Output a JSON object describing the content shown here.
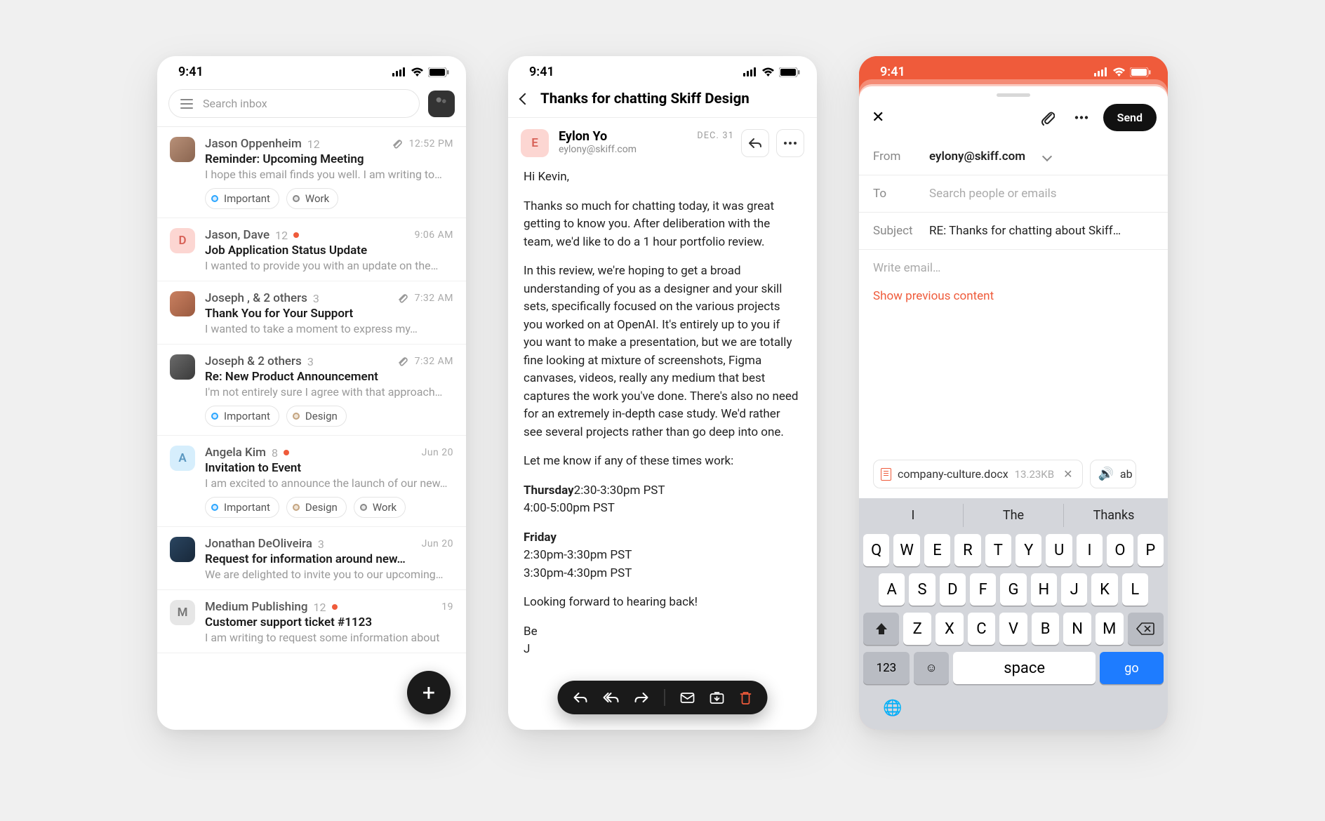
{
  "status": {
    "time": "9:41"
  },
  "inbox": {
    "searchPlaceholder": "Search inbox",
    "items": [
      {
        "sender": "Jason Oppenheim",
        "count": "12",
        "dot": false,
        "clip": true,
        "time": "12:52 PM",
        "subject": "Reminder: Upcoming Meeting",
        "preview": "I hope this email finds you well. I am writing to…",
        "avatar": "photo1",
        "tags": [
          {
            "c": "blue",
            "t": "Important"
          },
          {
            "c": "gray",
            "t": "Work"
          }
        ]
      },
      {
        "sender": "Jason, Dave",
        "count": "12",
        "dot": true,
        "clip": false,
        "time": "9:06 AM",
        "subject": "Job Application Status Update",
        "preview": "I wanted to provide you with an update on the…",
        "avatar": "pink",
        "avLetter": "D",
        "tags": []
      },
      {
        "sender": "Joseph , & 2 others",
        "count": "3",
        "dot": false,
        "clip": true,
        "time": "7:32 AM",
        "subject": "Thank You for Your Support",
        "preview": "I wanted to take a moment to express my…",
        "avatar": "photo2",
        "tags": []
      },
      {
        "sender": "Joseph & 2 others",
        "count": "3",
        "dot": false,
        "clip": true,
        "time": "7:32 AM",
        "subject": "Re: New Product Announcement",
        "preview": "I'm not entirely sure I agree with that approach…",
        "avatar": "photo3",
        "tags": [
          {
            "c": "blue",
            "t": "Important"
          },
          {
            "c": "tan",
            "t": "Design"
          }
        ]
      },
      {
        "sender": "Angela Kim",
        "count": "8",
        "dot": true,
        "clip": false,
        "time": "Jun 20",
        "subject": "Invitation to Event",
        "preview": "I am excited to announce the launch of our new…",
        "avatar": "blue",
        "avLetter": "A",
        "tags": [
          {
            "c": "blue",
            "t": "Important"
          },
          {
            "c": "tan",
            "t": "Design"
          },
          {
            "c": "gray",
            "t": "Work"
          }
        ]
      },
      {
        "sender": "Jonathan DeOliveira",
        "count": "3",
        "dot": false,
        "clip": false,
        "time": "Jun 20",
        "subject": "Request for information around new…",
        "preview": "We are delighted to invite you to our upcoming…",
        "avatar": "photo4",
        "tags": []
      },
      {
        "sender": "Medium Publishing",
        "count": "12",
        "dot": true,
        "clip": false,
        "time": "19",
        "subject": "Customer support ticket #1123",
        "preview": "I am writing to request some information about",
        "avatar": "grey",
        "avLetter": "M",
        "tags": []
      }
    ]
  },
  "reader": {
    "title": "Thanks for chatting Skiff Design",
    "sender": {
      "name": "Eylon Yo",
      "email": "eylony@skiff.com",
      "initial": "E",
      "date": "DEC. 31"
    },
    "greeting": "Hi Kevin,",
    "p1": "Thanks so much for chatting today, it was great getting to know you. After deliberation with the team, we'd like to do a 1 hour portfolio review.",
    "p2": "In this review, we're hoping to get a broad understanding of you as a designer and your skill sets, specifically focused on the various projects you worked on at OpenAI. It's entirely up to you if you want to make a presentation, but we are totally fine looking at mixture of screenshots, Figma canvases, videos, really any medium that best captures the work you've done. There's also no need for an extremely in-depth case study. We'd rather see several projects rather than go deep into one.",
    "p3": "Let me know if any of these times work:",
    "thuLabel": "Thursday",
    "thuSlot1": "2:30-3:30pm PST",
    "thuSlot2": "4:00-5:00pm PST",
    "friLabel": "Friday",
    "friSlot1": "2:30pm-3:30pm PST",
    "friSlot2": "3:30pm-4:30pm PST",
    "closing": "Looking forward to hearing back!"
  },
  "compose": {
    "fromLabel": "From",
    "fromVal": "eylony@skiff.com",
    "toLabel": "To",
    "toPlaceholder": "Search people or emails",
    "subjLabel": "Subject",
    "subjVal": "RE: Thanks for chatting about Skiff…",
    "bodyPlaceholder": "Write email…",
    "showPrev": "Show previous content",
    "sendLabel": "Send",
    "att1": {
      "name": "company-culture.docx",
      "size": "13.23KB"
    },
    "att2": {
      "tail": "ab"
    },
    "kb": {
      "sugs": [
        "I",
        "The",
        "Thanks"
      ],
      "r1": [
        "Q",
        "W",
        "E",
        "R",
        "T",
        "Y",
        "U",
        "I",
        "O",
        "P"
      ],
      "r2": [
        "A",
        "S",
        "D",
        "F",
        "G",
        "H",
        "J",
        "K",
        "L"
      ],
      "r3": [
        "Z",
        "X",
        "C",
        "V",
        "B",
        "N",
        "M"
      ],
      "numKey": "123",
      "space": "space",
      "go": "go"
    }
  }
}
